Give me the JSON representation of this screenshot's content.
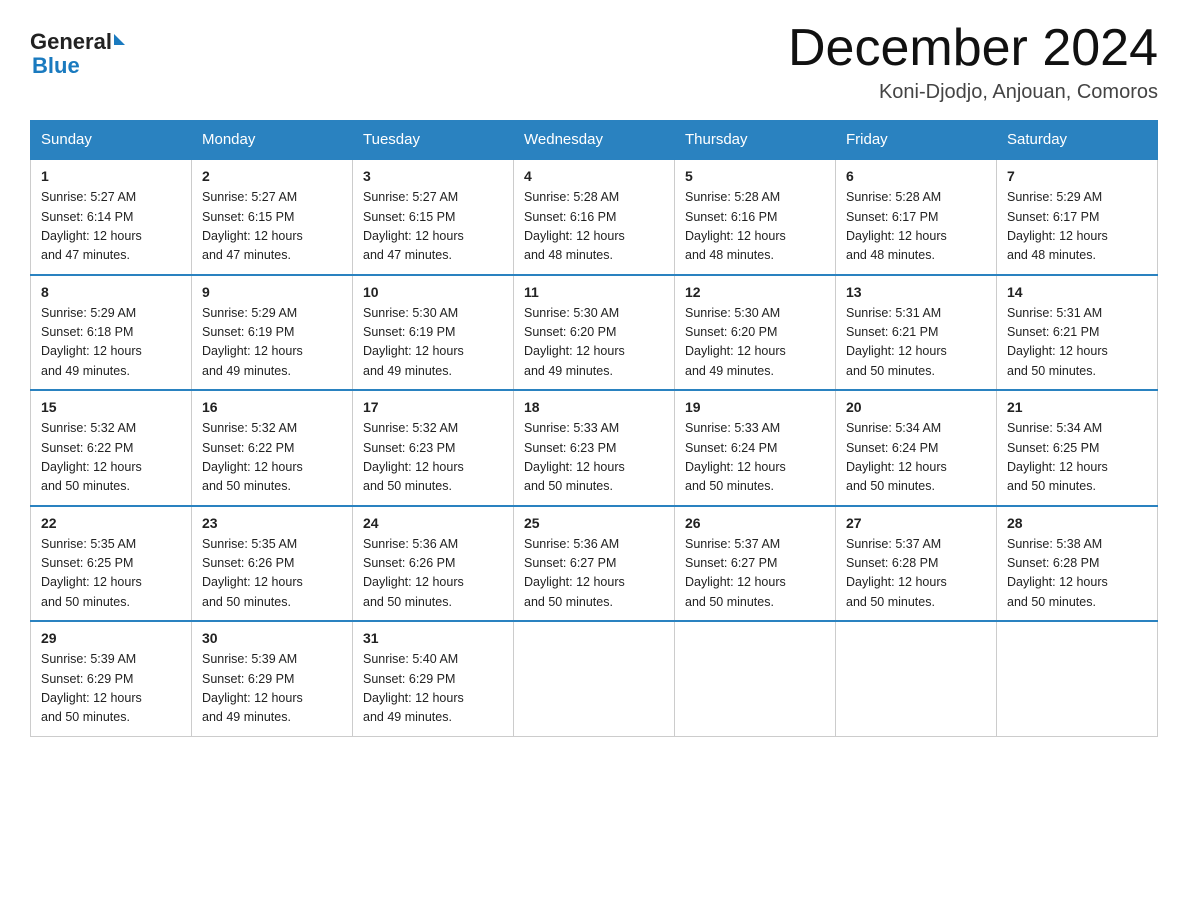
{
  "logo": {
    "text_general": "General",
    "text_blue": "Blue"
  },
  "title": "December 2024",
  "subtitle": "Koni-Djodjo, Anjouan, Comoros",
  "header": {
    "days": [
      "Sunday",
      "Monday",
      "Tuesday",
      "Wednesday",
      "Thursday",
      "Friday",
      "Saturday"
    ]
  },
  "weeks": [
    [
      {
        "day": "1",
        "sunrise": "5:27 AM",
        "sunset": "6:14 PM",
        "daylight": "12 hours and 47 minutes."
      },
      {
        "day": "2",
        "sunrise": "5:27 AM",
        "sunset": "6:15 PM",
        "daylight": "12 hours and 47 minutes."
      },
      {
        "day": "3",
        "sunrise": "5:27 AM",
        "sunset": "6:15 PM",
        "daylight": "12 hours and 47 minutes."
      },
      {
        "day": "4",
        "sunrise": "5:28 AM",
        "sunset": "6:16 PM",
        "daylight": "12 hours and 48 minutes."
      },
      {
        "day": "5",
        "sunrise": "5:28 AM",
        "sunset": "6:16 PM",
        "daylight": "12 hours and 48 minutes."
      },
      {
        "day": "6",
        "sunrise": "5:28 AM",
        "sunset": "6:17 PM",
        "daylight": "12 hours and 48 minutes."
      },
      {
        "day": "7",
        "sunrise": "5:29 AM",
        "sunset": "6:17 PM",
        "daylight": "12 hours and 48 minutes."
      }
    ],
    [
      {
        "day": "8",
        "sunrise": "5:29 AM",
        "sunset": "6:18 PM",
        "daylight": "12 hours and 49 minutes."
      },
      {
        "day": "9",
        "sunrise": "5:29 AM",
        "sunset": "6:19 PM",
        "daylight": "12 hours and 49 minutes."
      },
      {
        "day": "10",
        "sunrise": "5:30 AM",
        "sunset": "6:19 PM",
        "daylight": "12 hours and 49 minutes."
      },
      {
        "day": "11",
        "sunrise": "5:30 AM",
        "sunset": "6:20 PM",
        "daylight": "12 hours and 49 minutes."
      },
      {
        "day": "12",
        "sunrise": "5:30 AM",
        "sunset": "6:20 PM",
        "daylight": "12 hours and 49 minutes."
      },
      {
        "day": "13",
        "sunrise": "5:31 AM",
        "sunset": "6:21 PM",
        "daylight": "12 hours and 50 minutes."
      },
      {
        "day": "14",
        "sunrise": "5:31 AM",
        "sunset": "6:21 PM",
        "daylight": "12 hours and 50 minutes."
      }
    ],
    [
      {
        "day": "15",
        "sunrise": "5:32 AM",
        "sunset": "6:22 PM",
        "daylight": "12 hours and 50 minutes."
      },
      {
        "day": "16",
        "sunrise": "5:32 AM",
        "sunset": "6:22 PM",
        "daylight": "12 hours and 50 minutes."
      },
      {
        "day": "17",
        "sunrise": "5:32 AM",
        "sunset": "6:23 PM",
        "daylight": "12 hours and 50 minutes."
      },
      {
        "day": "18",
        "sunrise": "5:33 AM",
        "sunset": "6:23 PM",
        "daylight": "12 hours and 50 minutes."
      },
      {
        "day": "19",
        "sunrise": "5:33 AM",
        "sunset": "6:24 PM",
        "daylight": "12 hours and 50 minutes."
      },
      {
        "day": "20",
        "sunrise": "5:34 AM",
        "sunset": "6:24 PM",
        "daylight": "12 hours and 50 minutes."
      },
      {
        "day": "21",
        "sunrise": "5:34 AM",
        "sunset": "6:25 PM",
        "daylight": "12 hours and 50 minutes."
      }
    ],
    [
      {
        "day": "22",
        "sunrise": "5:35 AM",
        "sunset": "6:25 PM",
        "daylight": "12 hours and 50 minutes."
      },
      {
        "day": "23",
        "sunrise": "5:35 AM",
        "sunset": "6:26 PM",
        "daylight": "12 hours and 50 minutes."
      },
      {
        "day": "24",
        "sunrise": "5:36 AM",
        "sunset": "6:26 PM",
        "daylight": "12 hours and 50 minutes."
      },
      {
        "day": "25",
        "sunrise": "5:36 AM",
        "sunset": "6:27 PM",
        "daylight": "12 hours and 50 minutes."
      },
      {
        "day": "26",
        "sunrise": "5:37 AM",
        "sunset": "6:27 PM",
        "daylight": "12 hours and 50 minutes."
      },
      {
        "day": "27",
        "sunrise": "5:37 AM",
        "sunset": "6:28 PM",
        "daylight": "12 hours and 50 minutes."
      },
      {
        "day": "28",
        "sunrise": "5:38 AM",
        "sunset": "6:28 PM",
        "daylight": "12 hours and 50 minutes."
      }
    ],
    [
      {
        "day": "29",
        "sunrise": "5:39 AM",
        "sunset": "6:29 PM",
        "daylight": "12 hours and 50 minutes."
      },
      {
        "day": "30",
        "sunrise": "5:39 AM",
        "sunset": "6:29 PM",
        "daylight": "12 hours and 49 minutes."
      },
      {
        "day": "31",
        "sunrise": "5:40 AM",
        "sunset": "6:29 PM",
        "daylight": "12 hours and 49 minutes."
      },
      null,
      null,
      null,
      null
    ]
  ],
  "labels": {
    "sunrise": "Sunrise:",
    "sunset": "Sunset:",
    "daylight": "Daylight:"
  }
}
